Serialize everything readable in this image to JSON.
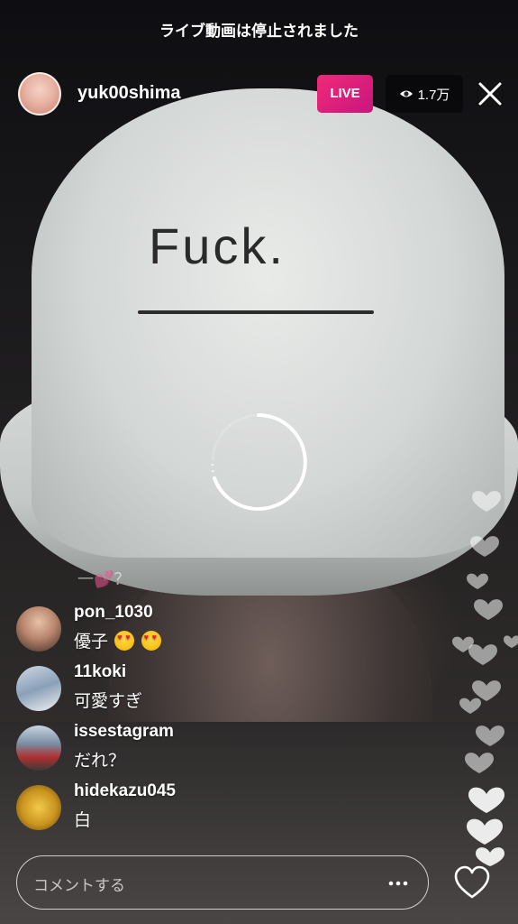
{
  "notice": "ライブ動画は停止されました",
  "host": {
    "username": "yuk00shima"
  },
  "live_badge": "LIVE",
  "viewer_count": "1.7万",
  "video": {
    "hat_text": "Fuck."
  },
  "partial_comment": "一💕？",
  "comments": [
    {
      "user": "pon_1030",
      "text": "優子"
    },
    {
      "user": "11koki",
      "text": "可愛すぎ"
    },
    {
      "user": "issestagram",
      "text": "だれ？"
    },
    {
      "user": "hidekazu045",
      "text": "白"
    }
  ],
  "comment_input": {
    "placeholder": "コメントする"
  },
  "icons": [
    "eye-icon",
    "close-icon",
    "loading-spinner-icon",
    "more-icon",
    "heart-icon"
  ],
  "colors": {
    "live": "#e91e77",
    "overlay": "#000000"
  }
}
